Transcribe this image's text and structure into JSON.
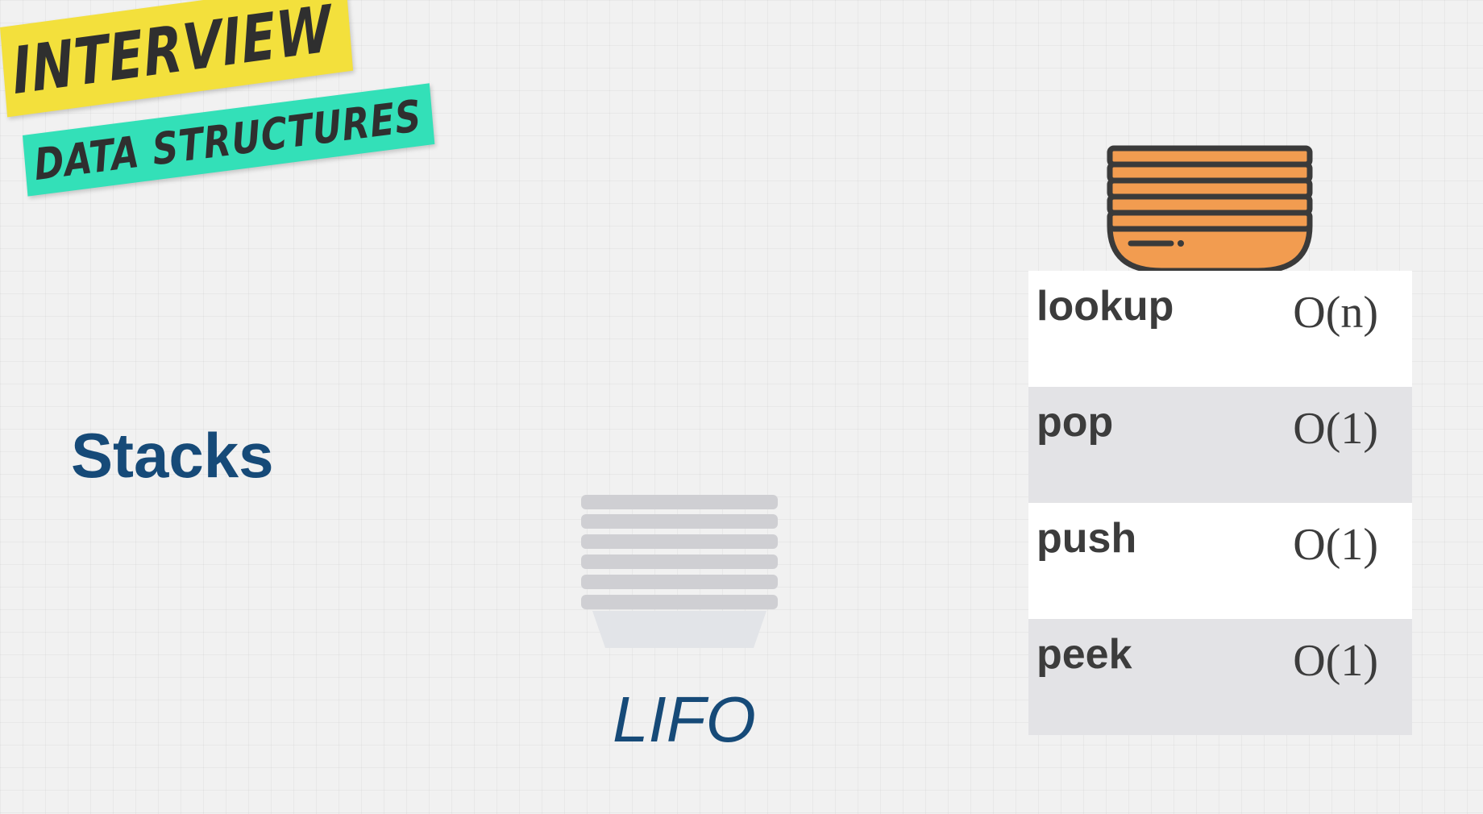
{
  "badge": {
    "line1": "INTERVIEW",
    "line2": "DATA STRUCTURES",
    "colors": {
      "line1_bg": "#f3e03c",
      "line2_bg": "#33e0b8",
      "text": "#2f2f2f"
    }
  },
  "title": "Stacks",
  "lifo_label": "LIFO",
  "icons": {
    "gray_stack": "plate-stack-icon",
    "orange_stack": "plate-stack-icon"
  },
  "colors": {
    "title": "#164a78",
    "orange": "#f29c50",
    "outline": "#3a3a3a",
    "gray_plate": "#cfcfd3"
  },
  "operations": [
    {
      "name": "lookup",
      "cost": "O(n)"
    },
    {
      "name": "pop",
      "cost": "O(1)"
    },
    {
      "name": "push",
      "cost": "O(1)"
    },
    {
      "name": "peek",
      "cost": "O(1)"
    }
  ]
}
